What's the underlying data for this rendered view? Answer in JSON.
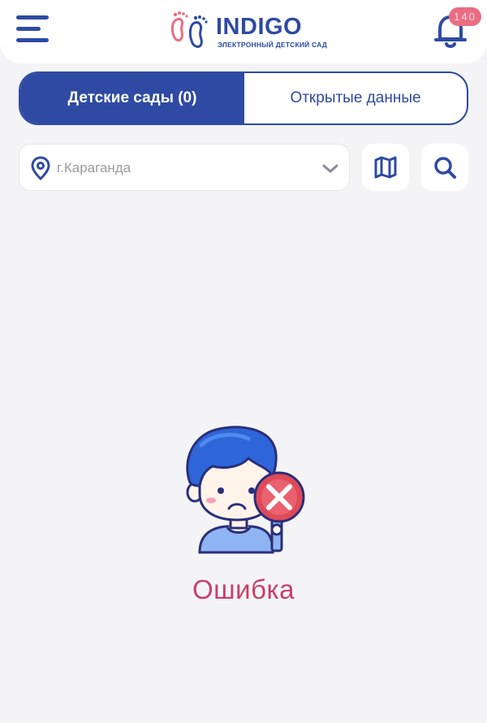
{
  "header": {
    "logo_title": "INDIGO",
    "logo_subtitle": "ЭЛЕКТРОННЫЙ ДЕТСКИЙ САД",
    "notification_count": "140",
    "menu_icon": "hamburger-menu-icon",
    "bell_icon": "bell-icon"
  },
  "tabs": [
    {
      "label": "Детские сады (0)",
      "active": true
    },
    {
      "label": "Открытые данные",
      "active": false
    }
  ],
  "filter": {
    "city_value": "г.Караганда",
    "pin_icon": "location-pin-icon",
    "dropdown_icon": "chevron-down-icon",
    "map_icon": "map-icon",
    "search_icon": "search-icon"
  },
  "empty_state": {
    "illustration": "sad-boy-with-error-sign",
    "message": "Ошибка"
  },
  "colors": {
    "primary": "#2e4aa3",
    "accent_pink": "#e96d83",
    "error_text": "#c73f6b",
    "background": "#f4f4f6"
  }
}
